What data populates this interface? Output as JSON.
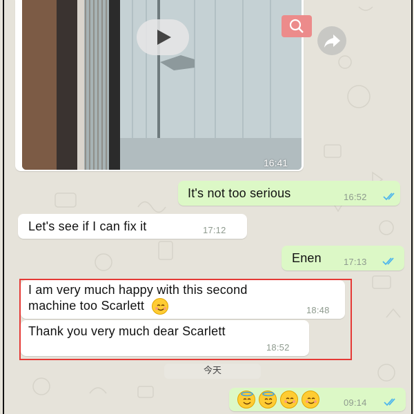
{
  "video_message": {
    "time": "16:41",
    "play_icon": "play-icon",
    "search_icon": "search-icon",
    "forward_icon": "forward-icon"
  },
  "messages": [
    {
      "id": "m1",
      "direction": "outgoing",
      "text": "It's not too serious",
      "time": "16:52",
      "read": true
    },
    {
      "id": "m2",
      "direction": "incoming",
      "text": "Let's see if I can fix it",
      "time": "17:12"
    },
    {
      "id": "m3",
      "direction": "outgoing",
      "text": "Enen",
      "time": "17:13",
      "read": true
    },
    {
      "id": "m4",
      "direction": "incoming",
      "line1": "I am very much happy with this second",
      "line2": "machine too Scarlett",
      "emoji": "smiling-face-emoji",
      "time": "18:48"
    },
    {
      "id": "m5",
      "direction": "incoming",
      "text": "Thank you very much dear Scarlett",
      "time": "18:52"
    },
    {
      "id": "m6",
      "direction": "outgoing",
      "emojis": [
        "halo-face-emoji",
        "halo-face-emoji",
        "smiling-face-emoji",
        "smiling-face-emoji"
      ],
      "time": "09:14",
      "read": true
    }
  ],
  "date_divider": "今天",
  "colors": {
    "background": "#e6e3da",
    "incoming_bubble": "#ffffff",
    "outgoing_bubble": "#dcf8c6",
    "read_ticks": "#4fb6ec",
    "highlight_border": "#e53935"
  }
}
